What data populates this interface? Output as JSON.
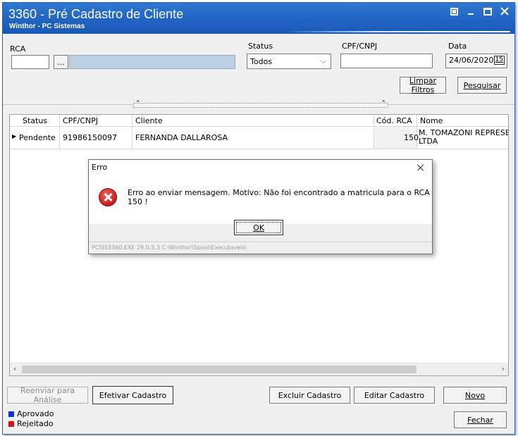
{
  "window": {
    "title": "3360 - Pré Cadastro de Cliente",
    "subtitle": "Winthor - PC Sistemas"
  },
  "filters": {
    "rca_label": "RCA",
    "rca_value": "",
    "rca_lookup_label": "...",
    "status_label": "Status",
    "status_value": "Todos",
    "cpf_label": "CPF/CNPJ",
    "cpf_value": "",
    "date_label": "Data",
    "date_value": "24/06/2020",
    "date_icon_text": "15",
    "clear_button": "Limpar Filtros",
    "search_button": "Pesquisar"
  },
  "grid": {
    "columns": [
      "Status",
      "CPF/CNPJ",
      "Cliente",
      "Cód. RCA",
      "Nome"
    ],
    "rows": [
      {
        "status": "Pendente",
        "cpf": "91986150097",
        "cliente": "FERNANDA DALLAROSA",
        "rca": "150",
        "nome": "M. TOMAZONI REPRESENTAC",
        "nome2": "LTDA"
      }
    ]
  },
  "dialog": {
    "title": "Erro",
    "message": "Erro ao enviar mensagem. Motivo: Não foi encontrado a matricula para o RCA 150 !",
    "ok_label": "OK",
    "footer": "PCSIS3360.EXE 29.0.5.3 C:\\Winthor\\Spool\\Executaveis\\"
  },
  "actions": {
    "resend": "Reenviar para Análise",
    "confirm": "Efetivar Cadastro",
    "delete": "Excluir Cadastro",
    "edit": "Editar Cadastro",
    "new": "Novo",
    "close": "Fechar"
  },
  "legend": [
    {
      "label": "Aprovado",
      "color": "#1030c8"
    },
    {
      "label": "Rejeitado",
      "color": "#d81010"
    }
  ]
}
